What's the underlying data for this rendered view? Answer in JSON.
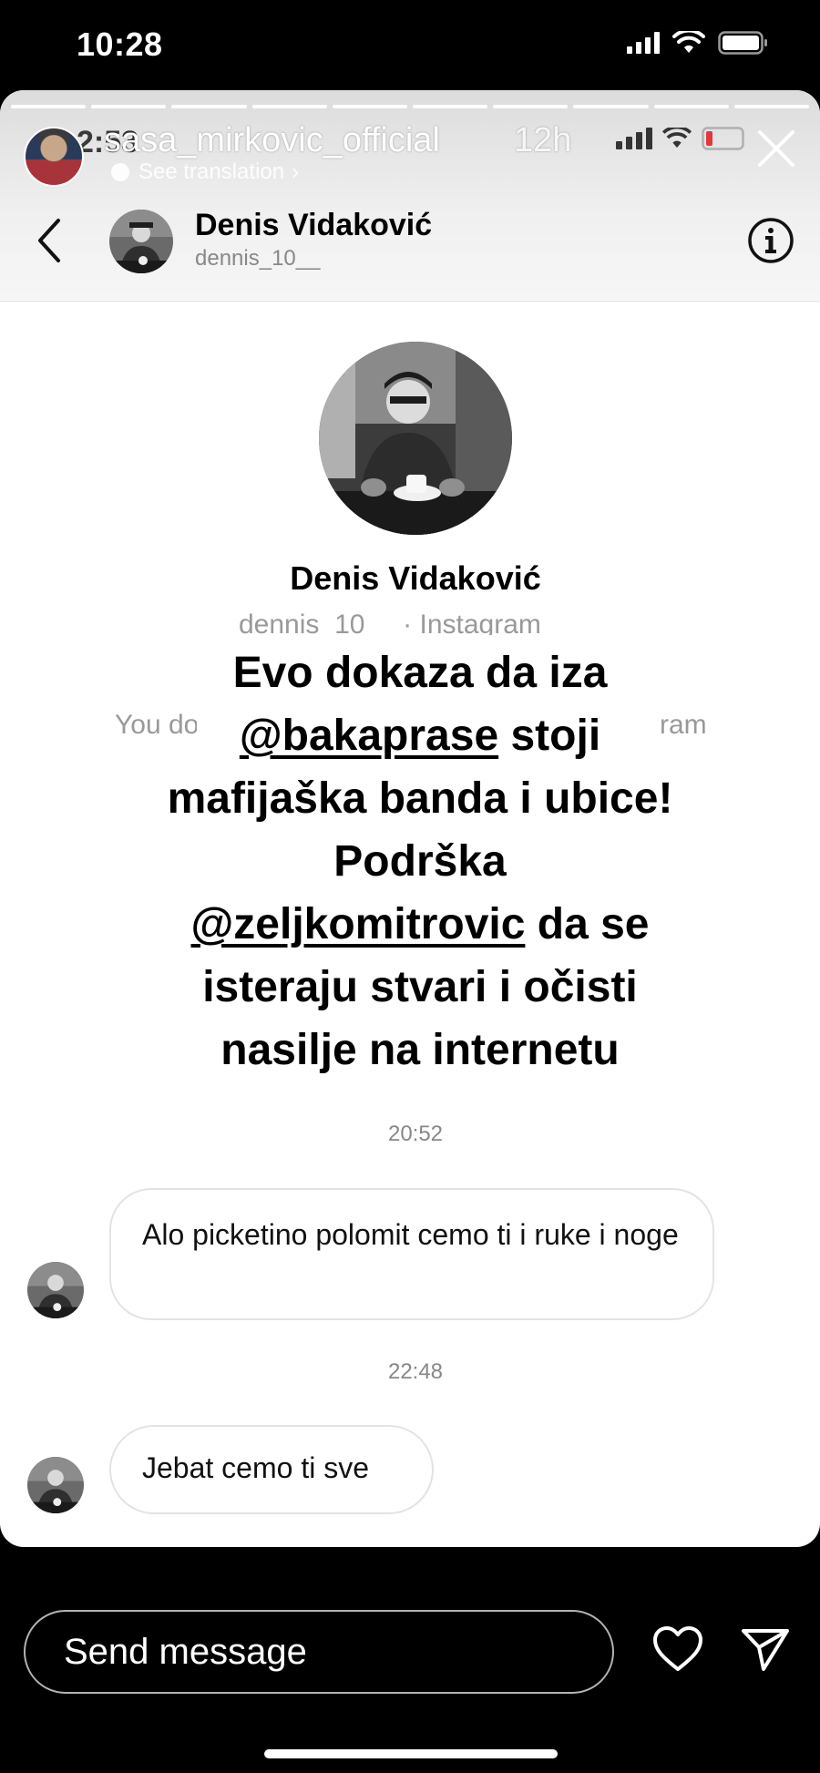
{
  "status_bar": {
    "time": "10:28"
  },
  "story": {
    "username": "sasa_mirkovic_official",
    "time": "12h",
    "see_translation": "See translation",
    "ghost_status_time": "2:53",
    "progress_segments": 10
  },
  "dm": {
    "contact_name": "Denis Vidaković",
    "contact_handle": "dennis_10__",
    "profile_name": "Denis Vidaković",
    "profile_subtitle": "dennis_10__ · Instagram",
    "hidden_text_left": "You don't",
    "hidden_text_right": "ram",
    "messages": [
      {
        "time": "20:52",
        "text": "Alo picketino polomit cemo ti i ruke i noge"
      },
      {
        "time": "22:48",
        "text": "Jebat cemo ti sve"
      }
    ]
  },
  "caption": {
    "line1": "Evo dokaza da iza",
    "mention1": "@bakaprase",
    "line2_rest": " stoji",
    "line3": "mafijaška banda i ubice!",
    "line4": "Podrška",
    "mention2": "@zeljkomitrovic",
    "line5_rest": " da se",
    "line6": "isteraju stvari i očisti",
    "line7": "nasilje na internetu"
  },
  "composer": {
    "placeholder": "Send message"
  },
  "colors": {
    "background": "#000000",
    "card": "#ffffff",
    "muted": "#888888",
    "battery_low": "#e0262b"
  }
}
